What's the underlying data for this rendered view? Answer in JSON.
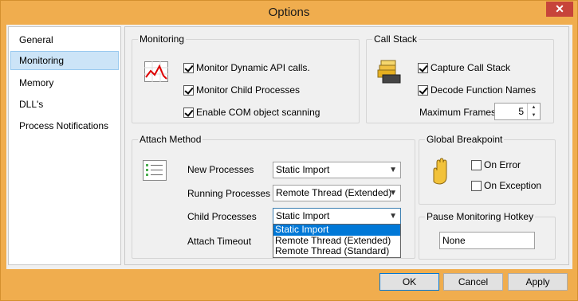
{
  "window": {
    "title": "Options",
    "close_glyph": "✕"
  },
  "nav": {
    "items": [
      {
        "label": "General",
        "selected": false
      },
      {
        "label": "Monitoring",
        "selected": true
      },
      {
        "label": "Memory",
        "selected": false
      },
      {
        "label": "DLL's",
        "selected": false
      },
      {
        "label": "Process Notifications",
        "selected": false
      }
    ]
  },
  "monitoring": {
    "label": "Monitoring",
    "icon": "line-chart-icon",
    "options": [
      {
        "label": "Monitor Dynamic API calls.",
        "checked": true
      },
      {
        "label": "Monitor Child Processes",
        "checked": true
      },
      {
        "label": "Enable COM object scanning",
        "checked": true
      }
    ]
  },
  "call_stack": {
    "label": "Call Stack",
    "icon": "stack-icon",
    "options": [
      {
        "label": "Capture Call Stack",
        "checked": true
      },
      {
        "label": "Decode Function Names",
        "checked": true
      }
    ],
    "max_frames_label": "Maximum Frames:",
    "max_frames_value": "5"
  },
  "attach_method": {
    "label": "Attach Method",
    "icon": "list-icon",
    "new_processes": {
      "label": "New Processes",
      "value": "Static Import"
    },
    "running_processes": {
      "label": "Running Processes",
      "value": "Remote Thread (Extended)"
    },
    "child_processes": {
      "label": "Child Processes",
      "value": "Static Import"
    },
    "attach_timeout": {
      "label": "Attach Timeout"
    },
    "dropdown_options": [
      "Static Import",
      "Remote Thread (Extended)",
      "Remote Thread (Standard)"
    ],
    "dropdown_highlight": "Static Import"
  },
  "global_breakpoint": {
    "label": "Global Breakpoint",
    "icon": "hand-icon",
    "options": [
      {
        "label": "On Error",
        "checked": false
      },
      {
        "label": "On Exception",
        "checked": false
      }
    ]
  },
  "pause_hotkey": {
    "label": "Pause Monitoring Hotkey",
    "value": "None"
  },
  "buttons": {
    "ok": "OK",
    "cancel": "Cancel",
    "apply": "Apply"
  },
  "colors": {
    "frame": "#f0ad4e",
    "close": "#c7443a",
    "selection": "#0078d7"
  }
}
